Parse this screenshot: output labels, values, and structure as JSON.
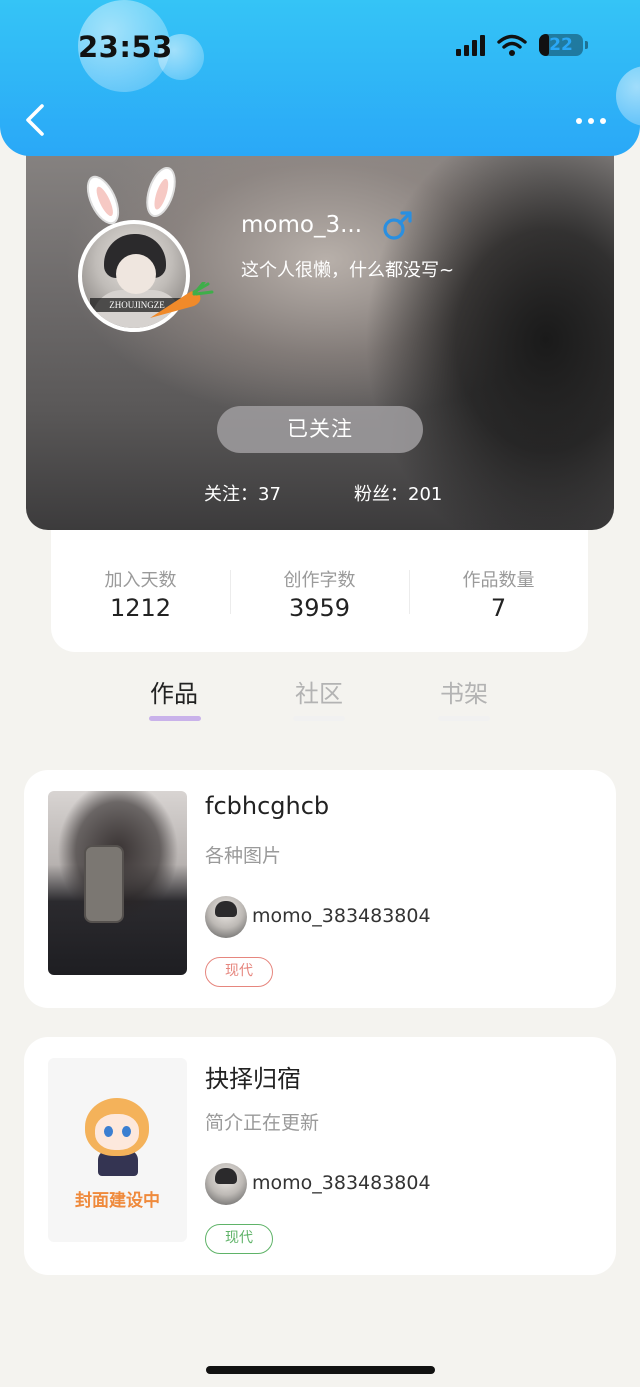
{
  "status_bar": {
    "time": "23:53",
    "battery": "22"
  },
  "profile": {
    "username": "momo_3...",
    "bio": "这个人很懒，什么都没写~",
    "follow_button": "已关注",
    "following_label": "关注：",
    "following_count": "37",
    "fans_label": "粉丝：",
    "fans_count": "201",
    "colors": {
      "gender_icon": "#2a8fe0",
      "header": "#2aa8f7"
    }
  },
  "stats": [
    {
      "label": "加入天数",
      "value": "1212"
    },
    {
      "label": "创作字数",
      "value": "3959"
    },
    {
      "label": "作品数量",
      "value": "7"
    }
  ],
  "tabs": [
    {
      "label": "作品",
      "active": true,
      "underline_color": "#c9b2ea"
    },
    {
      "label": "社区",
      "active": false
    },
    {
      "label": "书架",
      "active": false
    }
  ],
  "books": [
    {
      "title": "fcbhcghcb",
      "description": "各种图片",
      "author": "momo_383483804",
      "tag": "现代",
      "tag_color": "#e6867e"
    },
    {
      "title": "抉择归宿",
      "description": "简介正在更新",
      "author": "momo_383483804",
      "tag": "现代",
      "tag_color": "#5fb368",
      "cover_text": "封面建设中"
    }
  ]
}
